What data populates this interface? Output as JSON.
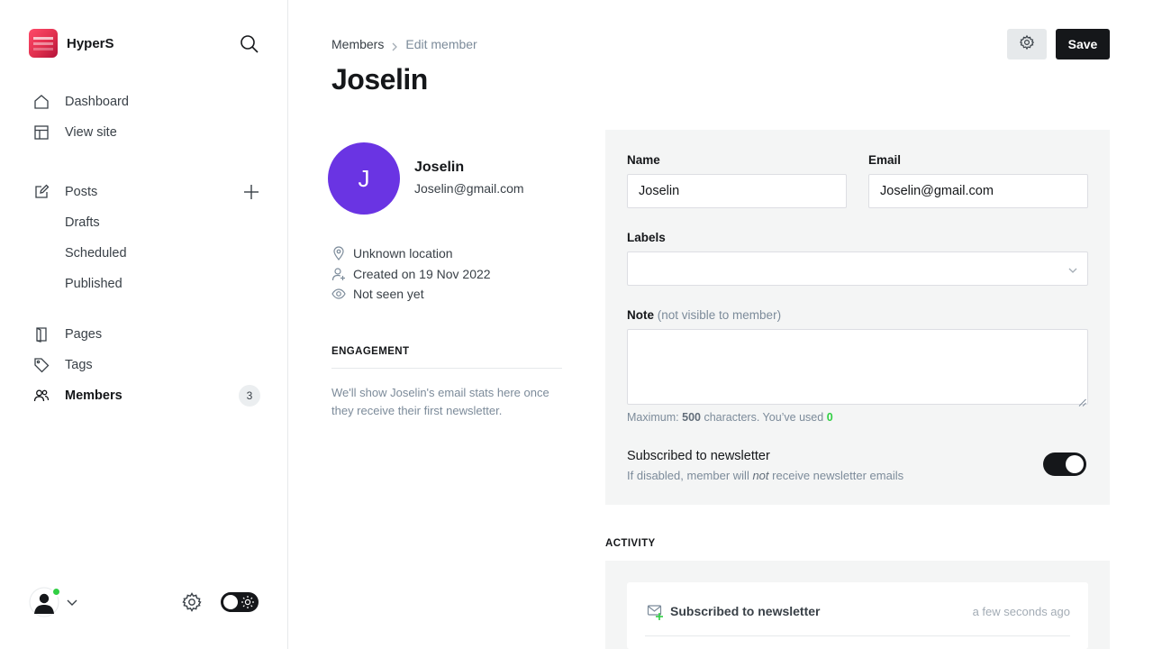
{
  "app": {
    "name": "HyperS"
  },
  "nav": {
    "dashboard": "Dashboard",
    "view_site": "View site",
    "posts": "Posts",
    "drafts": "Drafts",
    "scheduled": "Scheduled",
    "published": "Published",
    "pages": "Pages",
    "tags": "Tags",
    "members": "Members",
    "members_count": "3"
  },
  "breadcrumb": {
    "parent": "Members",
    "current": "Edit member"
  },
  "header": {
    "title": "Joselin",
    "save_label": "Save"
  },
  "member": {
    "initial": "J",
    "name": "Joselin",
    "email": "Joselin@gmail.com",
    "location": "Unknown location",
    "created": "Created on 19 Nov 2022",
    "seen": "Not seen yet"
  },
  "engagement": {
    "title": "ENGAGEMENT",
    "text": "We'll show Joselin's email stats here once they receive their first newsletter."
  },
  "form": {
    "name_label": "Name",
    "name_value": "Joselin",
    "email_label": "Email",
    "email_value": "Joselin@gmail.com",
    "labels_label": "Labels",
    "note_label": "Note",
    "note_hint": "(not visible to member)",
    "max_prefix": "Maximum:",
    "max_value": "500",
    "max_mid": "characters. You’ve used",
    "used_value": "0",
    "newsletter_title": "Subscribed to newsletter",
    "newsletter_desc_pre": "If disabled, member will",
    "newsletter_desc_em": "not",
    "newsletter_desc_post": "receive newsletter emails",
    "newsletter_enabled": true
  },
  "activity": {
    "title": "ACTIVITY",
    "items": [
      {
        "label": "Subscribed to newsletter",
        "time": "a few seconds ago"
      }
    ]
  },
  "colors": {
    "accent": "#15171a",
    "avatar": "#6a34e3",
    "success": "#30cf43"
  }
}
